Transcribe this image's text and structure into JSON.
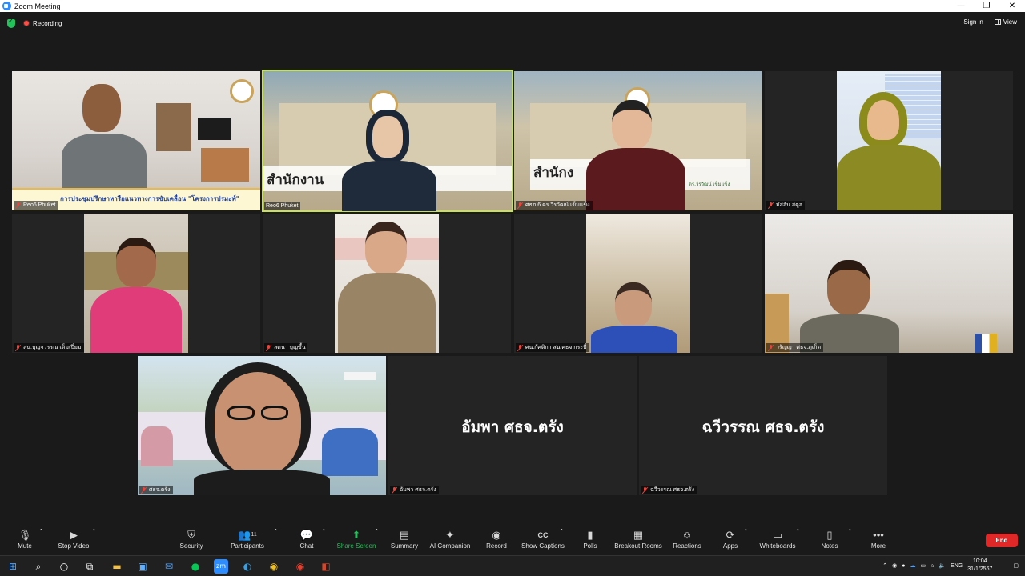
{
  "window": {
    "title": "Zoom Meeting"
  },
  "topbar": {
    "recording_label": "Recording",
    "sign_in": "Sign in",
    "view": "View"
  },
  "tiles": [
    {
      "name": "Reo6 Phuket",
      "banner": "การประชุมปรึกษาหารือแนวทางการขับเคลื่อน \"โครงการปรมะพ์\""
    },
    {
      "name": "Reo6 Phuket",
      "bg_text": "สำนักงาน          ภาค 6"
    },
    {
      "name": "ศธภ.6 ดร.วีรวัฒน์ เข็มแข็ง",
      "bg_text": "สำนักง           รภาค 6",
      "sub_text": "ดร.วีรวัฒน์ เข็มแข็ง"
    },
    {
      "name": "มัสลัน สตูล"
    },
    {
      "name": "สน.บุญจวรรณ เต็มเปี่ยม"
    },
    {
      "name": "ลดนา บุญขึ้น"
    },
    {
      "name": "ศน.กัศติกา สน.ศธจ กระบี่"
    },
    {
      "name": "วรัญญา ศธจ.ภูเก็ต"
    },
    {
      "name": "ศธจ.ตรัง"
    },
    {
      "name": "อัมพา ศธจ.ตรัง",
      "display": "อัมพา ศธจ.ตรัง"
    },
    {
      "name": "ฉวีวรรณ ศธจ.ตรัง",
      "display": "ฉวีวรรณ ศธจ.ตรัง"
    }
  ],
  "toolbar": {
    "mute": "Mute",
    "stop_video": "Stop Video",
    "security": "Security",
    "participants": "Participants",
    "participants_count": "11",
    "chat": "Chat",
    "share_screen": "Share Screen",
    "summary": "Summary",
    "ai_companion": "AI Companion",
    "record": "Record",
    "captions": "Show Captions",
    "polls": "Polls",
    "breakout": "Breakout Rooms",
    "reactions": "Reactions",
    "apps": "Apps",
    "whiteboards": "Whiteboards",
    "notes": "Notes",
    "more": "More",
    "end": "End"
  },
  "taskbar": {
    "lang": "ENG",
    "time": "10:04",
    "date": "31/1/2567"
  }
}
